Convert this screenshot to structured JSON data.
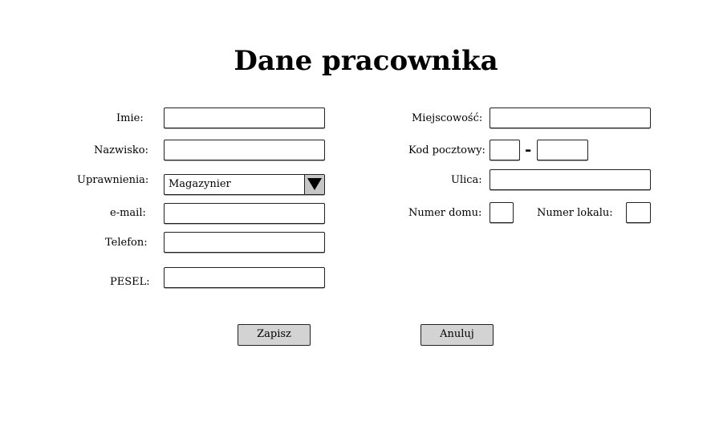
{
  "title": "Dane pracownika",
  "left": {
    "first_name": {
      "label": "Imie:",
      "value": ""
    },
    "last_name": {
      "label": "Nazwisko:",
      "value": ""
    },
    "permissions": {
      "label": "Uprawnienia:",
      "value": "Magazynier"
    },
    "email": {
      "label": "e-mail:",
      "value": ""
    },
    "phone": {
      "label": "Telefon:",
      "value": ""
    },
    "pesel": {
      "label": "PESEL:",
      "value": ""
    }
  },
  "right": {
    "city": {
      "label": "Miejscowość:",
      "value": ""
    },
    "postal_code": {
      "label": "Kod pocztowy:",
      "separator": "-",
      "part1": "",
      "part2": ""
    },
    "street": {
      "label": "Ulica:",
      "value": ""
    },
    "house_number": {
      "label": "Numer domu:",
      "value": ""
    },
    "apartment_number": {
      "label": "Numer lokalu:",
      "value": ""
    }
  },
  "buttons": {
    "save": "Zapisz",
    "cancel": "Anuluj"
  },
  "icons": {
    "dropdown": "triangle-down-icon"
  },
  "colors": {
    "button_bg": "#d3d3d3",
    "dropdown_button_bg": "#c6c6c6",
    "border": "#222222"
  }
}
